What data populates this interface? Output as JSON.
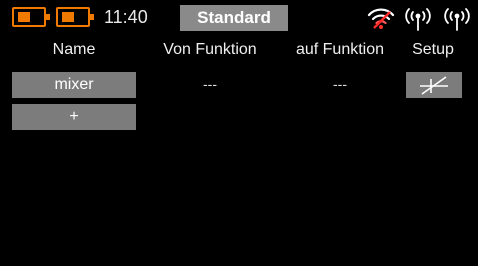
{
  "status": {
    "clock": "11:40",
    "model_name": "Standard",
    "tx_battery_level": 0.55,
    "rx_battery_level": 0.55,
    "battery_color": "#f07a00",
    "wifi_icon": "wifi-signal-icon",
    "antenna_icons": [
      "antenna-signal-icon",
      "antenna-signal-icon"
    ]
  },
  "table": {
    "headers": {
      "name": "Name",
      "von": "Von Funktion",
      "auf": "auf Funktion",
      "setup": "Setup"
    },
    "rows": [
      {
        "name": "mixer",
        "von": "---",
        "auf": "---",
        "setup_icon": "curve-setup-icon"
      }
    ],
    "add_label": "+"
  }
}
